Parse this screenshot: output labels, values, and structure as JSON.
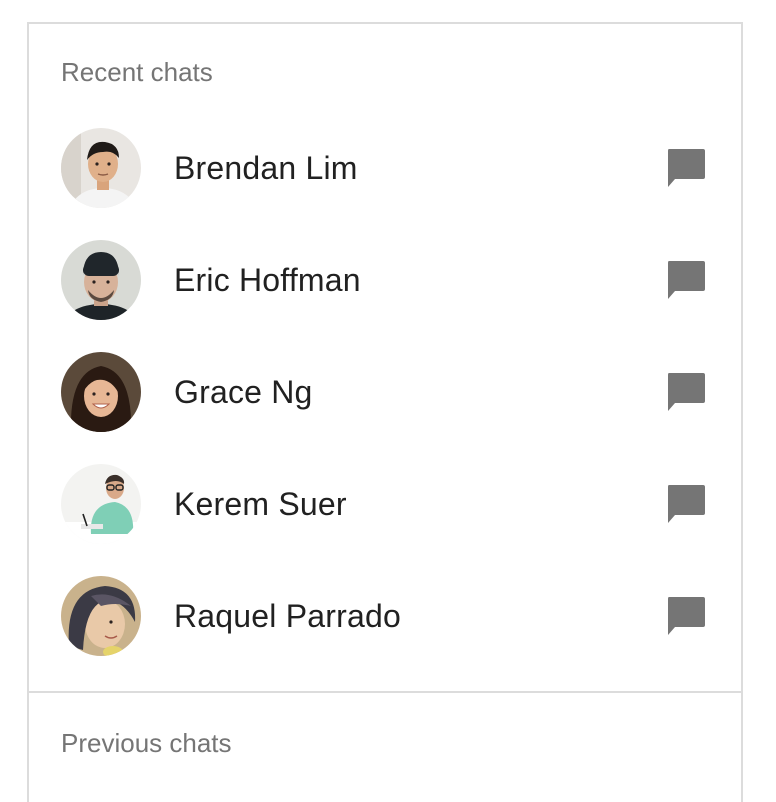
{
  "recent": {
    "header": "Recent chats",
    "items": [
      {
        "name": "Brendan Lim",
        "avatar": "brendan-lim-avatar",
        "icon": "chat-bubble-icon"
      },
      {
        "name": "Eric Hoffman",
        "avatar": "eric-hoffman-avatar",
        "icon": "chat-bubble-icon"
      },
      {
        "name": "Grace Ng",
        "avatar": "grace-ng-avatar",
        "icon": "chat-bubble-icon"
      },
      {
        "name": "Kerem Suer",
        "avatar": "kerem-suer-avatar",
        "icon": "chat-bubble-icon"
      },
      {
        "name": "Raquel Parrado",
        "avatar": "raquel-parrado-avatar",
        "icon": "chat-bubble-icon"
      }
    ]
  },
  "previous": {
    "header": "Previous chats"
  },
  "colors": {
    "header_text": "#757575",
    "name_text": "#212121",
    "icon": "#757575",
    "divider": "#dcdcdc"
  }
}
